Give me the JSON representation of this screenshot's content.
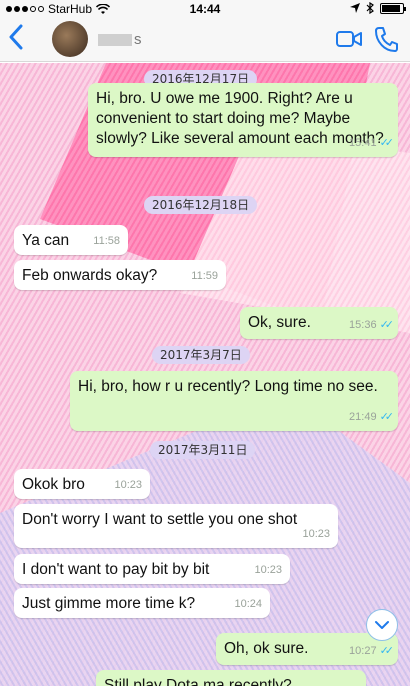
{
  "status_bar": {
    "carrier": "StarHub",
    "time": "14:44",
    "battery_level": 0.9
  },
  "header": {
    "back_icon": "chevron-left-icon",
    "contact_name": "s",
    "video_icon": "video-camera-icon",
    "phone_icon": "phone-icon"
  },
  "dates": [
    {
      "label": "2016年12月17日"
    },
    {
      "label": "2016年12月18日"
    },
    {
      "label": "2017年3月7日"
    },
    {
      "label": "2017年3月11日"
    }
  ],
  "messages": [
    {
      "dir": "out",
      "text": "Hi, bro. U owe me 1900. Right? Are u convenient to start doing me? Maybe slowly? Like several amount each month?",
      "time": "15:41",
      "read": true
    },
    {
      "dir": "in",
      "text": "Ya can",
      "time": "11:58"
    },
    {
      "dir": "in",
      "text": "Feb onwards okay?",
      "time": "11:59"
    },
    {
      "dir": "out",
      "text": "Ok, sure.",
      "time": "15:36",
      "read": true
    },
    {
      "dir": "out",
      "text": "Hi, bro, how r u recently? Long time no see.",
      "time": "21:49",
      "read": true
    },
    {
      "dir": "in",
      "text": "Okok bro",
      "time": "10:23"
    },
    {
      "dir": "in",
      "text": "Don't worry I want to settle you one shot",
      "time": "10:23"
    },
    {
      "dir": "in",
      "text": "I don't want to pay bit by bit",
      "time": "10:23"
    },
    {
      "dir": "in",
      "text": "Just gimme more time k?",
      "time": "10:24"
    },
    {
      "dir": "out",
      "text": "Oh, ok sure.",
      "time": "10:27",
      "read": true
    },
    {
      "dir": "out",
      "text": "Still play Dota ma recently?",
      "time": "",
      "read": false
    }
  ],
  "scroll_button_icon": "chevron-down-icon"
}
